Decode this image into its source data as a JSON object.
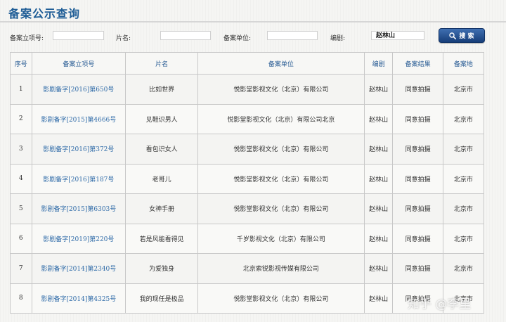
{
  "page": {
    "title": "备案公示查询"
  },
  "search": {
    "record_no_label": "备案立项号:",
    "record_no_value": "",
    "film_title_label": "片名:",
    "film_title_value": "",
    "unit_label": "备案单位:",
    "unit_value": "",
    "writer_label": "编剧:",
    "writer_value": "赵林山",
    "button_label": "搜 索"
  },
  "table": {
    "headers": [
      "序号",
      "备案立项号",
      "片名",
      "备案单位",
      "编剧",
      "备案结果",
      "备案地"
    ],
    "rows": [
      {
        "no": "1",
        "record": "影剧备字[2016]第650号",
        "title": "比如世界",
        "unit": "悦影堂影视文化（北京）有限公司",
        "writer": "赵林山",
        "result": "同意拍摄",
        "place": "北京市"
      },
      {
        "no": "2",
        "record": "影剧备字[2015]第4666号",
        "title": "见鞋识男人",
        "unit": "悦影堂影视文化（北京）有限公司北京",
        "writer": "赵林山",
        "result": "同意拍摄",
        "place": "北京市"
      },
      {
        "no": "3",
        "record": "影剧备字[2016]第372号",
        "title": "看包识女人",
        "unit": "悦影堂影视文化（北京）有限公司",
        "writer": "赵林山",
        "result": "同意拍摄",
        "place": "北京市"
      },
      {
        "no": "4",
        "record": "影剧备字[2016]第187号",
        "title": "老哥儿",
        "unit": "悦影堂影视文化（北京）有限公司",
        "writer": "赵林山",
        "result": "同意拍摄",
        "place": "北京市"
      },
      {
        "no": "5",
        "record": "影剧备字[2015]第6303号",
        "title": "女神手册",
        "unit": "悦影堂影视文化（北京）有限公司",
        "writer": "赵林山",
        "result": "同意拍摄",
        "place": "北京市"
      },
      {
        "no": "6",
        "record": "影剧备字[2019]第220号",
        "title": "若是风能看得见",
        "unit": "千岁影视文化（北京）有限公司",
        "writer": "赵林山",
        "result": "同意拍摄",
        "place": "北京市"
      },
      {
        "no": "7",
        "record": "影剧备字[2014]第2340号",
        "title": "为爱独身",
        "unit": "北京索锐影视传媒有限公司",
        "writer": "赵林山",
        "result": "同意拍摄",
        "place": "北京市"
      },
      {
        "no": "8",
        "record": "影剧备字[2014]第4325号",
        "title": "我的现任是极品",
        "unit": "悦影堂影视文化（北京）有限公司",
        "writer": "赵林山",
        "result": "同意拍摄",
        "place": "北京市"
      }
    ]
  },
  "watermark": "知乎 @李里",
  "icons": {
    "search_button_icon": "magnifier-icon"
  },
  "colors": {
    "title": "#1f5d96",
    "link": "#2f6ba8",
    "button": "#173e79"
  }
}
